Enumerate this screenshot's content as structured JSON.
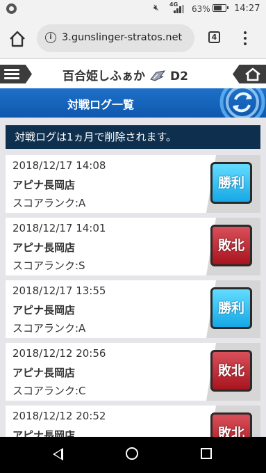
{
  "status_bar": {
    "network_type": "4G",
    "battery_percent": "63%",
    "time": "14:27",
    "icons": [
      "app-notification-icon",
      "mute-icon",
      "signal-icon",
      "battery-icon"
    ]
  },
  "browser": {
    "url": "3.gunslinger-stratos.net",
    "tab_count": "4",
    "icons": [
      "home-icon",
      "info-icon",
      "tab-switcher-icon",
      "more-menu-icon"
    ]
  },
  "game_header": {
    "player_name": "百合姫しふぁか",
    "rank": "D2",
    "icons": [
      "hamburger-menu-icon",
      "rank-emblem-icon",
      "home-icon"
    ]
  },
  "page_title": "対戦ログ一覧",
  "notice": "対戦ログは1ヵ月で削除されます。",
  "logs": [
    {
      "datetime": "2018/12/17 14:08",
      "store": "アピナ長岡店",
      "score_rank": "スコアランク:A",
      "result": "勝利",
      "outcome": "win"
    },
    {
      "datetime": "2018/12/17 14:01",
      "store": "アピナ長岡店",
      "score_rank": "スコアランク:S",
      "result": "敗北",
      "outcome": "lose"
    },
    {
      "datetime": "2018/12/17 13:55",
      "store": "アピナ長岡店",
      "score_rank": "スコアランク:A",
      "result": "勝利",
      "outcome": "win"
    },
    {
      "datetime": "2018/12/12 20:56",
      "store": "アピナ長岡店",
      "score_rank": "スコアランク:C",
      "result": "敗北",
      "outcome": "lose"
    },
    {
      "datetime": "2018/12/12 20:52",
      "store": "アピナ長岡店",
      "score_rank": "",
      "result": "敗北",
      "outcome": "lose"
    }
  ],
  "colors": {
    "header_blue": "#1565c0",
    "notice_bg": "#0f2f4e",
    "win_badge": "#22b5ee",
    "lose_badge": "#c0262f"
  },
  "nav_bar": {
    "icons": [
      "back-icon",
      "home-circle-icon",
      "recent-apps-icon"
    ]
  }
}
